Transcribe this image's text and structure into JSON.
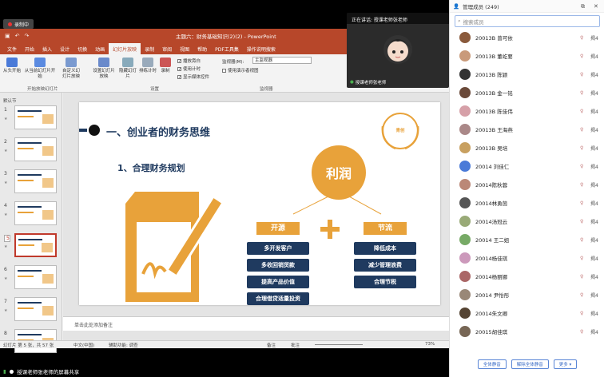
{
  "recording": {
    "label": "录制中"
  },
  "ppt": {
    "doc_title": "主题六：财务基础知识(2)(2) - PowerPoint",
    "tabs": [
      "文件",
      "开始",
      "插入",
      "设计",
      "切换",
      "动画",
      "幻灯片放映",
      "录制",
      "审阅",
      "视图",
      "帮助",
      "PDF工具集",
      "操作说明搜索"
    ],
    "active_tab": "幻灯片放映",
    "ribbon": {
      "from_start": "从头开始",
      "from_current": "从当前幻灯片开始",
      "custom": "自定义幻灯片放映",
      "setup": "设置幻灯片放映",
      "hide": "隐藏幻灯片",
      "rehearse": "排练计时",
      "record": "录制",
      "chk_narration": "播放旁白",
      "chk_timing": "使用计时",
      "chk_media": "显示媒体控件",
      "monitor_label": "监视器(M):",
      "monitor_value": "主监视器",
      "presenter_view": "使用演示者视图",
      "group_start": "开始放映幻灯片",
      "group_setup": "设置",
      "group_monitor": "监视器"
    },
    "section": "默认节",
    "slide_numbers": [
      "1",
      "2",
      "3",
      "4",
      "5",
      "6",
      "7",
      "8"
    ],
    "notes_placeholder": "单击此处添加备注",
    "status": {
      "slide_info": "幻灯片 第 5 张，共 57 张",
      "lang": "中文(中国)",
      "accessibility": "辅助功能: 调查",
      "notes": "备注",
      "comments": "批注",
      "zoom": "73%"
    }
  },
  "slide": {
    "heading": "一、创业者的财务思维",
    "subheading": "1、合理财务规划",
    "center": "利润",
    "left_title": "开源",
    "right_title": "节流",
    "left_items": [
      "多开发客户",
      "多收回销货款",
      "提高产品价值",
      "合理借贷适量投资"
    ],
    "right_items": [
      "降低成本",
      "减少管理浪费",
      "合理节税"
    ],
    "badge": "青创"
  },
  "speaker": {
    "now_speaking": "正在讲话: 授课老师张老师",
    "name": "授课老师张老师"
  },
  "share": {
    "label": "授课老师张老师的屏幕共享"
  },
  "panel": {
    "title": "管理成员 (249)",
    "search_placeholder": "搜索成员",
    "members": [
      {
        "name": "20013B 曾可依",
        "tag": "揭4"
      },
      {
        "name": "20013B 董屹要",
        "tag": "揭4"
      },
      {
        "name": "20013B 陈颖",
        "tag": "揭4"
      },
      {
        "name": "20013B 金一铭",
        "tag": "揭4"
      },
      {
        "name": "20013B 陈佳伟",
        "tag": "揭4"
      },
      {
        "name": "20013B 王海燕",
        "tag": "揭4"
      },
      {
        "name": "20013B 吴培",
        "tag": "揭4"
      },
      {
        "name": "20014  刘佳仁",
        "tag": "揭4"
      },
      {
        "name": "20014陈秋蓉",
        "tag": "揭4"
      },
      {
        "name": "20014林勇茵",
        "tag": "揭4"
      },
      {
        "name": "20014汤冠云",
        "tag": "揭4"
      },
      {
        "name": "20014 王二姐",
        "tag": "揭4"
      },
      {
        "name": "20014杨佳琪",
        "tag": "揭4"
      },
      {
        "name": "20014杨丽娜",
        "tag": "揭4"
      },
      {
        "name": "20014 尹怡彤",
        "tag": "揭4"
      },
      {
        "name": "20014朱文卿",
        "tag": "揭4"
      },
      {
        "name": "20015胡佳琪",
        "tag": "揭4"
      }
    ],
    "avatar_colors": [
      "#8a5a3c",
      "#c99a7a",
      "#333",
      "#6b4a3a",
      "#d6a0a8",
      "#a88",
      "#c8a060",
      "#4a7ad8",
      "#b87",
      "#555",
      "#9a7",
      "#7a6",
      "#c9b",
      "#a66",
      "#987",
      "#543",
      "#765"
    ],
    "btn_mute_all": "全体静音",
    "btn_unmute_all": "解除全体静音",
    "btn_more": "更多 ▾"
  },
  "colors": {
    "ppt_red": "#b7472a",
    "slide_orange": "#e8a23a",
    "slide_navy": "#1f3a5f"
  }
}
